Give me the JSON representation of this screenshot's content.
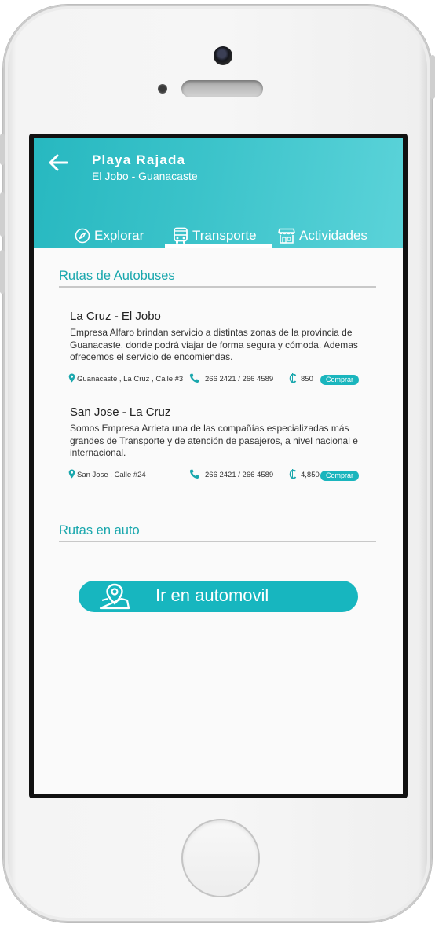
{
  "header": {
    "title": "Playa Rajada",
    "subtitle": "El Jobo - Guanacaste"
  },
  "tabs": [
    {
      "label": "Explorar",
      "icon": "compass-icon",
      "active": false
    },
    {
      "label": "Transporte",
      "icon": "bus-icon",
      "active": true
    },
    {
      "label": "Actividades",
      "icon": "store-icon",
      "active": false
    }
  ],
  "bus_section": {
    "heading": "Rutas de Autobuses",
    "routes": [
      {
        "name": "La Cruz - El Jobo",
        "description": "Empresa Alfaro brindan servicio a distintas zonas de la provincia de Guanacaste, donde podrá viajar de forma segura y cómoda. Ademas ofrecemos el servicio de encomiendas.",
        "address": "Guanacaste , La Cruz , Calle #3",
        "phone": "266 2421 / 266 4589",
        "price": "850",
        "buy_label": "Comprar"
      },
      {
        "name": "San Jose - La Cruz",
        "description": "Somos Empresa Arrieta una de las compañías especializadas más grandes de Transporte y de atención de pasajeros, a nivel nacional e internacional.",
        "address": "San Jose , Calle #24",
        "phone": "266 2421 / 266 4589",
        "price": "4,850",
        "buy_label": "Comprar"
      }
    ]
  },
  "car_section": {
    "heading": "Rutas en auto",
    "button_label": "Ir en automovil",
    "button_icon": "map-pin-icon"
  },
  "colors": {
    "accent": "#1aa7ad",
    "header_start": "#27b8c0",
    "header_end": "#5bd3d9",
    "button": "#17b6bf"
  }
}
